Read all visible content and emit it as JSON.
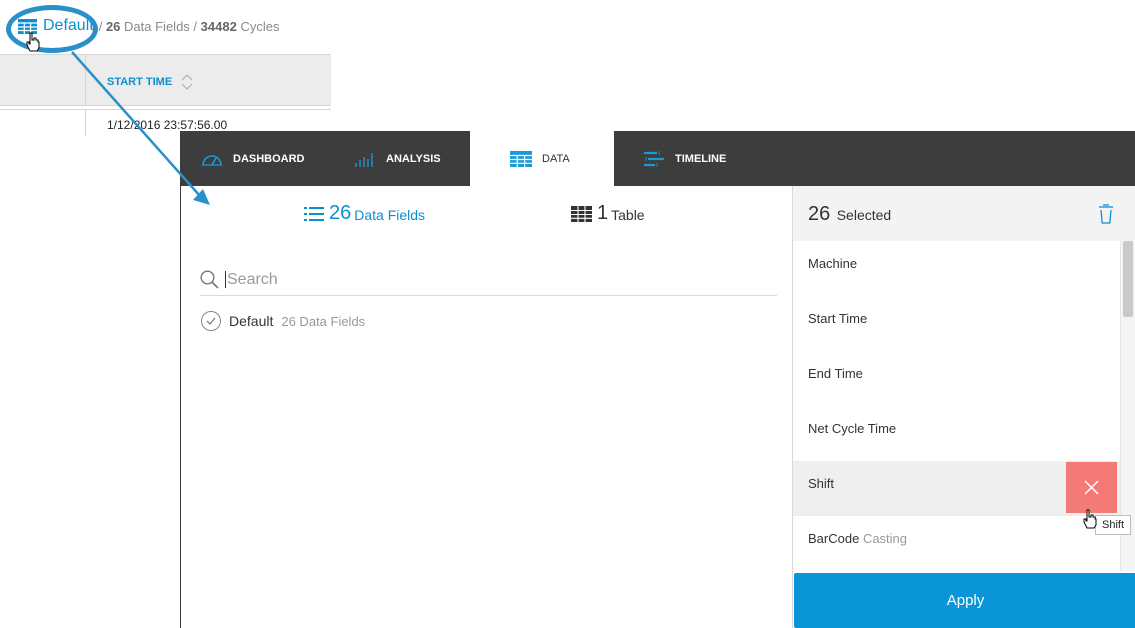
{
  "breadcrumb": {
    "dataset_name": "Default",
    "separator": "/",
    "fields_count": "26",
    "fields_label": "Data Fields",
    "cycles_count": "34482",
    "cycles_label": "Cycles"
  },
  "background_table": {
    "column_header": "START TIME",
    "first_cell": "1/12/2016 23:57:56.00"
  },
  "tabs": [
    {
      "label": "DASHBOARD",
      "icon": "gauge-icon",
      "active": false
    },
    {
      "label": "ANALYSIS",
      "icon": "bar-chart-icon",
      "active": false
    },
    {
      "label": "DATA",
      "icon": "table-grid-icon",
      "active": true
    },
    {
      "label": "TIMELINE",
      "icon": "timeline-icon",
      "active": false
    }
  ],
  "data_panel": {
    "fields_count": "26",
    "fields_label": "Data Fields",
    "table_count": "1",
    "table_label": "Table",
    "search_placeholder": "Search",
    "datasets": [
      {
        "name": "Default",
        "count_label": "26 Data Fields",
        "checked": true
      }
    ]
  },
  "selected_panel": {
    "count": "26",
    "label": "Selected",
    "items": [
      {
        "label": "Machine",
        "sublabel": ""
      },
      {
        "label": "Start Time",
        "sublabel": ""
      },
      {
        "label": "End Time",
        "sublabel": ""
      },
      {
        "label": "Net Cycle Time",
        "sublabel": ""
      },
      {
        "label": "Shift",
        "sublabel": ""
      },
      {
        "label": "BarCode",
        "sublabel": "Casting"
      }
    ],
    "hovered_item": "Shift",
    "apply_label": "Apply"
  },
  "tooltip": {
    "text": "Shift"
  },
  "colors": {
    "accent": "#0a95d6",
    "tab_bar": "#3d3d3d",
    "remove": "#f47a78",
    "callout_ring": "#2b90c9"
  }
}
